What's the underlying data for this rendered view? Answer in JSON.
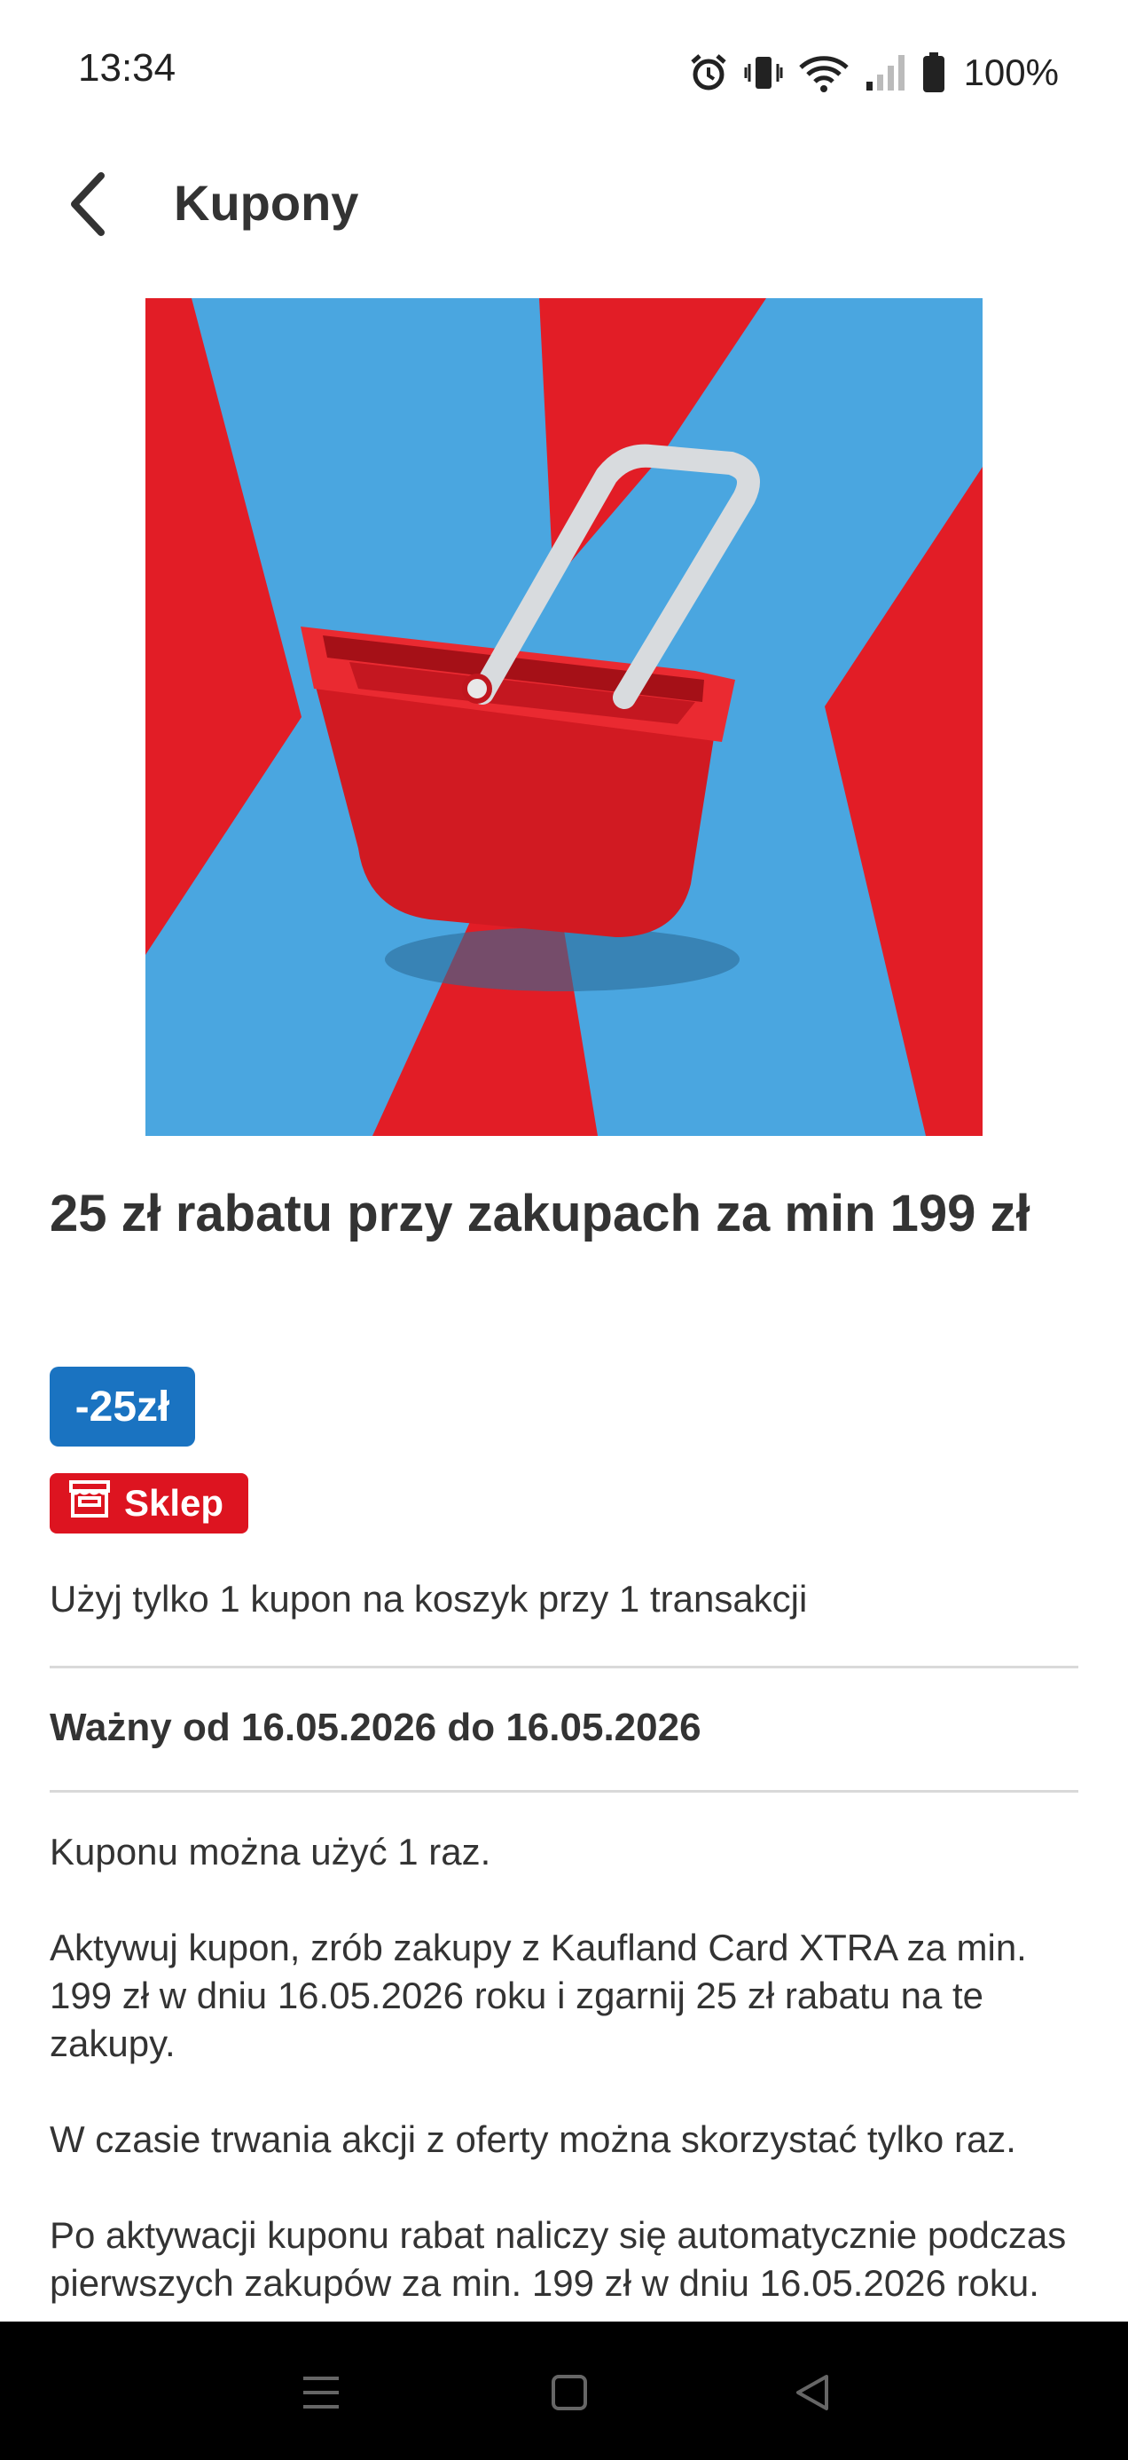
{
  "status_bar": {
    "time": "13:34",
    "battery": "100%",
    "icons": [
      "alarm-icon",
      "vibrate-icon",
      "wifi-icon",
      "signal-icon",
      "battery-icon"
    ]
  },
  "app_bar": {
    "back_icon": "back-arrow-icon",
    "title": "Kupony"
  },
  "coupon": {
    "image_alt": "shopping-basket-image",
    "title": "25 zł rabatu przy zakupach za min 199 zł",
    "discount": "-25zł",
    "store_badge": "Sklep",
    "usage_note": "Użyj tylko 1 kupon na koszyk przy 1 transakcji",
    "validity": "Ważny od 16.05.2026 do 16.05.2026",
    "description": [
      "Kuponu można użyć 1 raz.",
      "Aktywuj kupon, zrób zakupy z Kaufland Card XTRA za min. 199 zł w dniu 16.05.2026 roku i zgarnij 25 zł rabatu na te zakupy.",
      "W czasie trwania akcji z oferty można skorzystać tylko raz.",
      "Po aktywacji kuponu rabat naliczy się automatycznie podczas pierwszych zakupów za min. 199 zł w dniu 16.05.2026 roku."
    ]
  },
  "colors": {
    "discount_badge": "#1a73c1",
    "store_badge": "#dd1420",
    "hero_blue": "#4aa6e0",
    "hero_red": "#e21d26"
  },
  "nav_bar": {
    "buttons": [
      "menu-icon",
      "home-icon",
      "back-icon"
    ]
  }
}
